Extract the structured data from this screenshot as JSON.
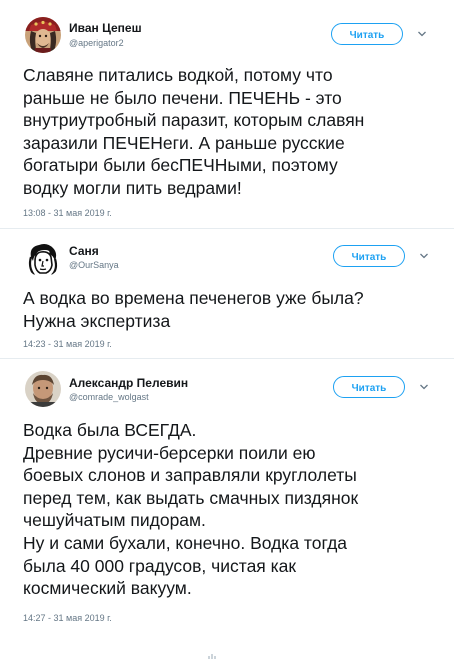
{
  "tweets": [
    {
      "author_name": "Иван Цепеш",
      "author_handle": "@aperigator2",
      "follow_label": "Читать",
      "text": "Славяне питались водкой, потому что\nраньше не было печени. ПЕЧЕНЬ - это\nвнутриутробный паразит, которым славян\nзаразили ПЕЧЕНеги. А раньше русские\nбогатыри были бесПЕЧНыми, поэтому\nводку могли пить ведрами!",
      "timestamp": "13:08 - 31 мая 2019 г."
    },
    {
      "author_name": "Саня",
      "author_handle": "@OurSanya",
      "follow_label": "Читать",
      "text": "А водка во времена печенегов уже была?\nНужна экспертиза",
      "timestamp": "14:23 - 31 мая 2019 г."
    },
    {
      "author_name": "Александр Пелевин",
      "author_handle": "@comrade_wolgast",
      "follow_label": "Читать",
      "text": "Водка была ВСЕГДА.\nДревние русичи-берсерки поили ею\nбоевых слонов и заправляли круглолеты\nперед тем, как выдать смачных пиздянок\nчешуйчатым пидорам.\nНу и сами бухали, конечно. Водка тогда\nбыла 40 000 градусов, чистая как\nкосмический вакуум.",
      "timestamp": "14:27 - 31 мая 2019 г."
    }
  ],
  "icons": {
    "more": "chevron-down-icon",
    "bottom": "share-icon"
  },
  "colors": {
    "accent": "#1da1f2",
    "text": "#14171a",
    "muted": "#657786",
    "divider": "#e6ecf0"
  }
}
